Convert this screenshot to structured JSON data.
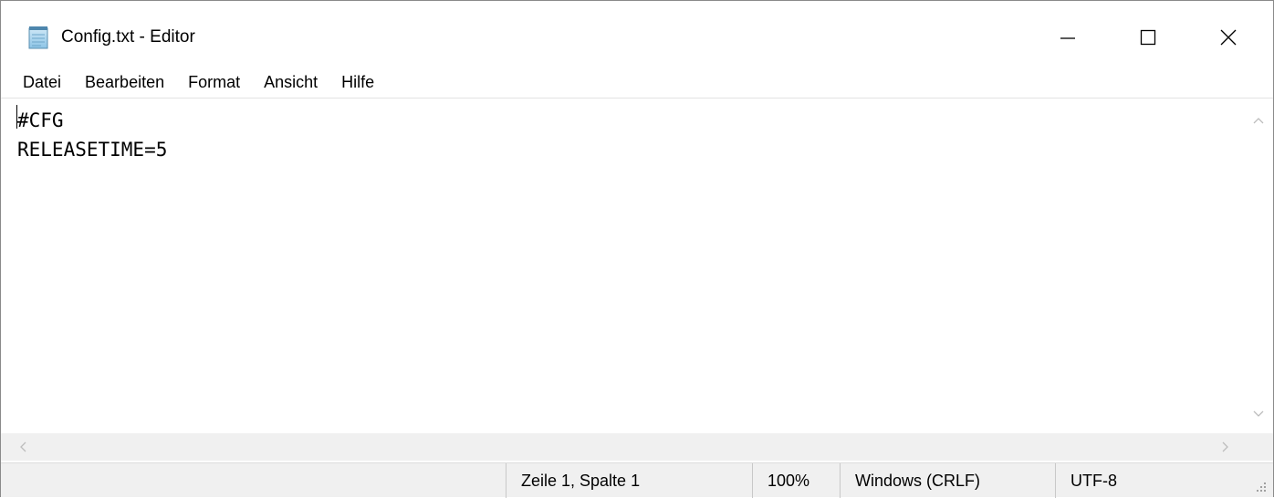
{
  "window": {
    "title": "Config.txt - Editor",
    "icon": "notepad-icon",
    "controls": {
      "minimize": "minimize-icon",
      "maximize": "maximize-icon",
      "close": "close-icon"
    }
  },
  "menu": {
    "items": [
      "Datei",
      "Bearbeiten",
      "Format",
      "Ansicht",
      "Hilfe"
    ]
  },
  "editor": {
    "lines": [
      "#CFG",
      "RELEASETIME=5"
    ]
  },
  "status": {
    "position": "Zeile 1, Spalte 1",
    "zoom": "100%",
    "line_ending": "Windows (CRLF)",
    "encoding": "UTF-8"
  },
  "colors": {
    "chrome": "#f0f0f0",
    "text": "#000000",
    "background": "#ffffff"
  }
}
